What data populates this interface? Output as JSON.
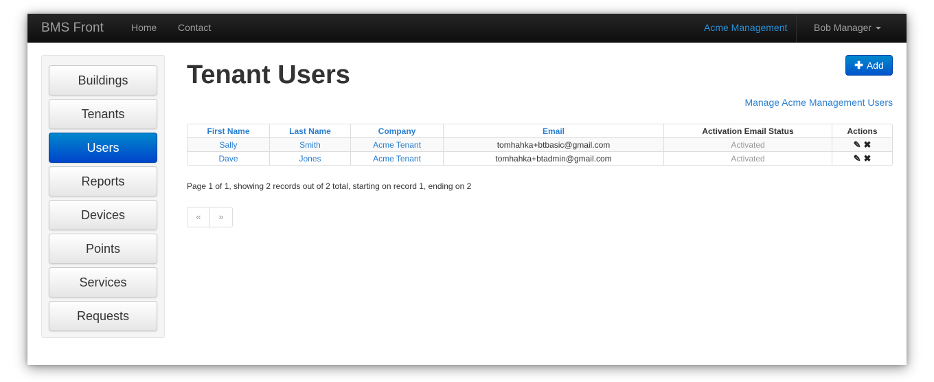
{
  "navbar": {
    "brand": "BMS Front",
    "links": [
      "Home",
      "Contact"
    ],
    "org": "Acme Management",
    "user": "Bob Manager"
  },
  "sidebar": {
    "items": [
      {
        "label": "Buildings"
      },
      {
        "label": "Tenants"
      },
      {
        "label": "Users",
        "active": true
      },
      {
        "label": "Reports"
      },
      {
        "label": "Devices"
      },
      {
        "label": "Points"
      },
      {
        "label": "Services"
      },
      {
        "label": "Requests"
      }
    ]
  },
  "main": {
    "title": "Tenant Users",
    "add_label": "Add",
    "manage_link": "Manage Acme Management Users",
    "table": {
      "headers": [
        "First Name",
        "Last Name",
        "Company",
        "Email",
        "Activation Email Status",
        "Actions"
      ],
      "rows": [
        {
          "first": "Sally",
          "last": "Smith",
          "company": "Acme Tenant",
          "email": "tomhahka+btbasic@gmail.com",
          "status": "Activated"
        },
        {
          "first": "Dave",
          "last": "Jones",
          "company": "Acme Tenant",
          "email": "tomhahka+btadmin@gmail.com",
          "status": "Activated"
        }
      ]
    },
    "paging_text": "Page 1 of 1, showing 2 records out of 2 total, starting on record 1, ending on 2",
    "pager": {
      "prev": "«",
      "next": "»"
    }
  },
  "icons": {
    "add": "plus-icon",
    "edit": "edit-icon",
    "delete": "delete-icon"
  },
  "colors": {
    "accent": "#0066cc",
    "link": "#2a7fd0",
    "navbar": "#1b1b1b"
  }
}
